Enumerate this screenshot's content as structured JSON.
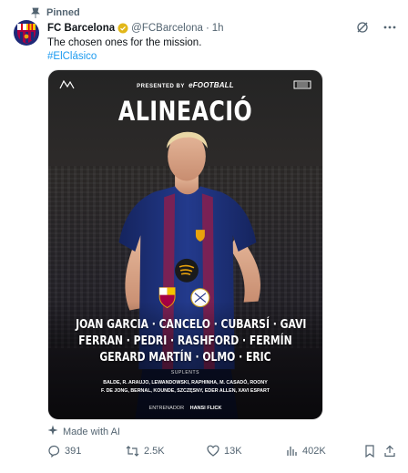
{
  "pinned": {
    "label": "Pinned"
  },
  "tweet": {
    "author_name": "FC Barcelona",
    "author_handle": "@FCBarcelona",
    "separator": "·",
    "time": "1h",
    "text": "The chosen ones for the mission.",
    "hashtag": "#ElClásico"
  },
  "media": {
    "presented_by": "PRESENTED BY",
    "sponsor": "eFOOTBALL",
    "title": "ALINEACIÓ",
    "lineup": [
      "JOAN GARCIA · CANCELO · CUBARSÍ · GAVI",
      "FERRAN · PEDRI · RASHFORD · FERMÍN",
      "GERARD MARTÍN · OLMO · ERIC"
    ],
    "subs_label": "SUPLENTS",
    "subs_lines": [
      "BALDE, R. ARAUJO, LEWANDOWSKI, RAPHINHA, M. CASADÓ, ROONY",
      "F. DE JONG, BERNAL, KOUNDE, SZCZĘSNY, EDER ALLEN, XAVI ESPART"
    ],
    "coach_label": "ENTRENADOR",
    "coach_name": "HANSI FLICK"
  },
  "made_with_ai": "Made with AI",
  "actions": {
    "replies": "391",
    "reposts": "2.5K",
    "likes": "13K",
    "views": "402K"
  },
  "icons": [
    "pin-icon",
    "verified-badge-icon",
    "grok-icon",
    "more-icon",
    "ai-sparkle-icon",
    "reply-icon",
    "repost-icon",
    "like-icon",
    "views-icon",
    "bookmark-icon",
    "share-icon"
  ],
  "colors": {
    "link": "#1d9bf0",
    "muted": "#536471",
    "text": "#0f1419",
    "verified": "#e2b719",
    "barca_blue": "#1e2a78",
    "barca_red": "#a50044"
  }
}
